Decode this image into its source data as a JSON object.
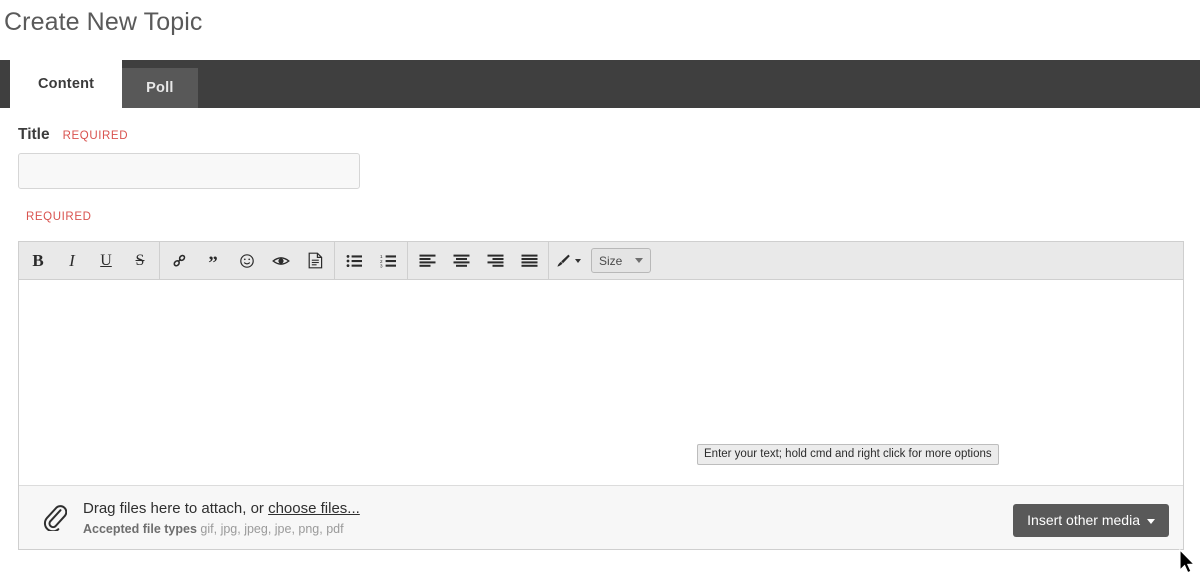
{
  "page": {
    "title": "Create New Topic"
  },
  "tabs": [
    {
      "label": "Content",
      "active": true,
      "name": "tab-content"
    },
    {
      "label": "Poll",
      "active": false,
      "name": "tab-poll"
    }
  ],
  "form": {
    "title_field": {
      "label": "Title",
      "required_tag": "REQUIRED",
      "value": "",
      "placeholder": ""
    },
    "body_field": {
      "required_tag": "REQUIRED"
    }
  },
  "editor": {
    "toolbar": {
      "groups": [
        {
          "buttons": [
            {
              "name": "bold-icon",
              "label": "B"
            },
            {
              "name": "italic-icon",
              "label": "I"
            },
            {
              "name": "underline-icon",
              "label": "U"
            },
            {
              "name": "strikethrough-icon",
              "label": "S"
            }
          ]
        },
        {
          "buttons": [
            {
              "name": "link-icon",
              "label": ""
            },
            {
              "name": "quote-icon",
              "label": "”"
            },
            {
              "name": "emoji-icon",
              "label": ""
            },
            {
              "name": "spoiler-eye-icon",
              "label": ""
            },
            {
              "name": "code-block-icon",
              "label": ""
            }
          ]
        },
        {
          "buttons": [
            {
              "name": "unordered-list-icon",
              "label": ""
            },
            {
              "name": "ordered-list-icon",
              "label": ""
            }
          ]
        },
        {
          "buttons": [
            {
              "name": "align-left-icon",
              "label": ""
            },
            {
              "name": "align-center-icon",
              "label": ""
            },
            {
              "name": "align-right-icon",
              "label": ""
            },
            {
              "name": "align-justify-icon",
              "label": ""
            }
          ]
        },
        {
          "buttons": [
            {
              "name": "text-color-brush-icon",
              "label": ""
            }
          ]
        }
      ],
      "size_select": {
        "label": "Size"
      }
    },
    "content": "",
    "tooltip": "Enter your text; hold cmd and right click for more options"
  },
  "attachments": {
    "drag_text_prefix": "Drag files here to attach, or ",
    "choose_files_link": "choose files...",
    "accepted_label": "Accepted file types",
    "accepted_types": "gif, jpg, jpeg, jpe, png, pdf"
  },
  "buttons": {
    "insert_other_media": "Insert other media"
  },
  "colors": {
    "tabbar_background": "#3f3f3f",
    "active_tab_background": "#ffffff",
    "inactive_tab_background": "#585858",
    "required_red": "#d9534f",
    "toolbar_background": "#e9e9e9",
    "footer_background": "#f7f7f7",
    "button_dark": "#595959"
  }
}
